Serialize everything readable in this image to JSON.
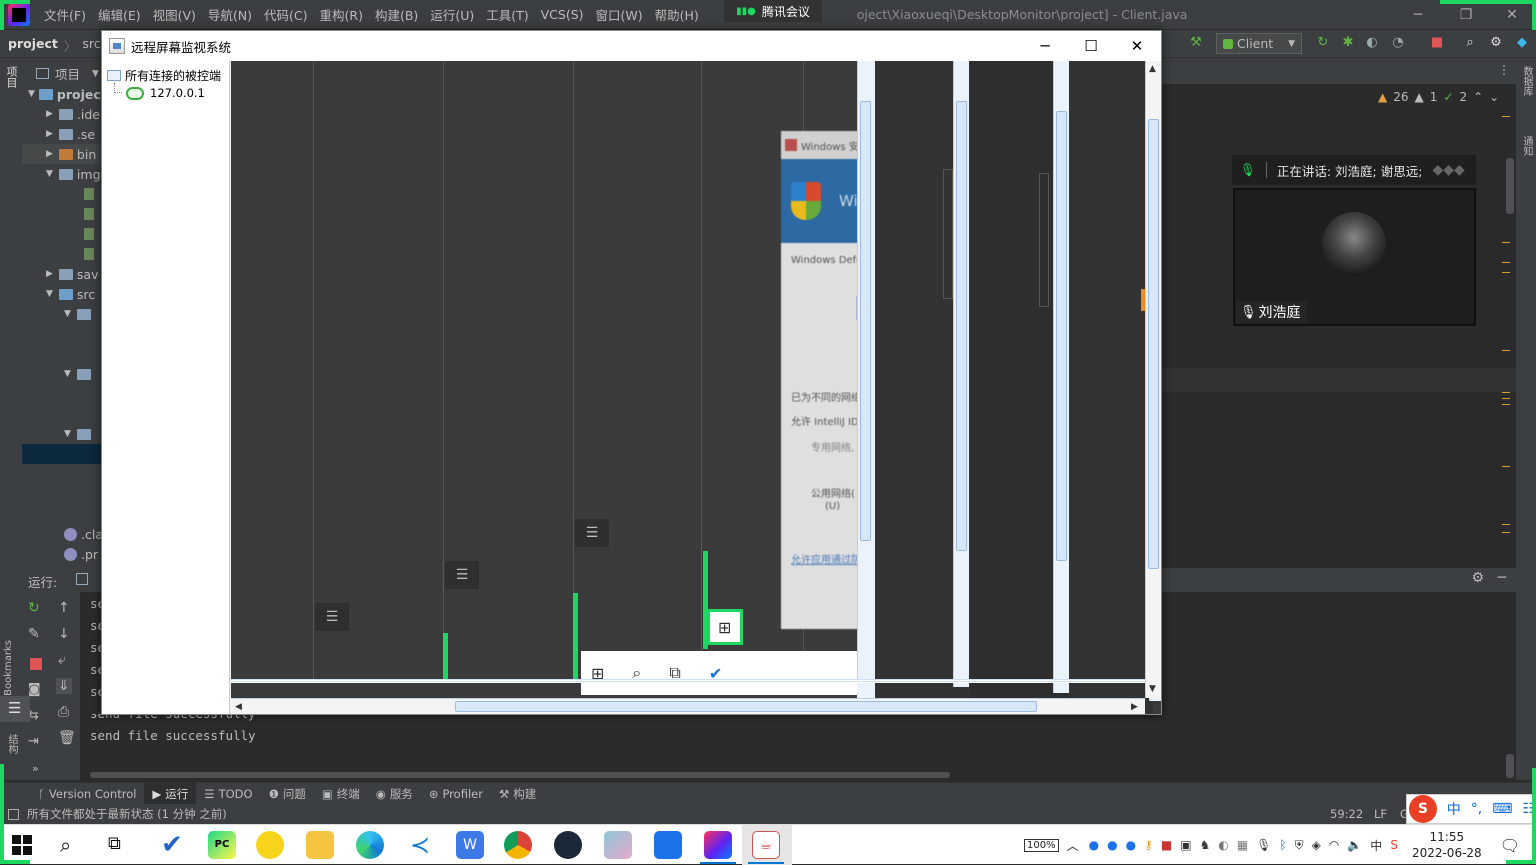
{
  "ide": {
    "menu": [
      "文件(F)",
      "编辑(E)",
      "视图(V)",
      "导航(N)",
      "代码(C)",
      "重构(R)",
      "构建(B)",
      "运行(U)",
      "工具(T)",
      "VCS(S)",
      "窗口(W)",
      "帮助(H)"
    ],
    "title_left": "proj",
    "title_right": "oject\\Xiaoxueqi\\DesktopMonitor\\project] - Client.java",
    "breadcrumb": [
      "project",
      "src"
    ],
    "run_config": "Client",
    "inspections": {
      "warnings": "26",
      "weak": "1",
      "typos": "2"
    },
    "project_label": "项目",
    "tree": [
      ".ide",
      ".se",
      "bin",
      "img",
      "sav",
      "src",
      ".cla",
      ".pr"
    ],
    "tree_root": "projec",
    "run_label": "运行:",
    "console": [
      "se",
      "se",
      "se",
      "se",
      "se",
      "send file successfully",
      "send file successfully"
    ],
    "bookmarks": "Bookmarks",
    "structure": "结构",
    "right_strip": [
      "数据库",
      "通知"
    ],
    "bottom_tabs": [
      "Version Control",
      "运行",
      "TODO",
      "问题",
      "终端",
      "服务",
      "Profiler",
      "构建"
    ],
    "status_text": "所有文件都处于最新状态 (1 分钟 之前)",
    "position": "59:22",
    "line_sep": "LF",
    "encoding": "G"
  },
  "meeting": {
    "badge": "腾讯会议",
    "speaking": "正在讲话: 刘浩庭; 谢思远;",
    "speaker": "刘浩庭"
  },
  "monitor": {
    "title": "远程屏幕监视系统",
    "tree_root": "所有连接的被控端",
    "client_ip": "127.0.0.1",
    "captured": {
      "sec_title": "Windows 安全",
      "sec_head": "Wind",
      "sec_defender": "Windows Defend",
      "sec_line1": "已为不同的网络类",
      "sec_line2": "允许 IntelliJ IDEA",
      "sec_opt1": "专用网络,",
      "sec_opt2": "公用网络(",
      "sec_opt3": "(U)",
      "sec_link": "允许应用通过防火"
    }
  },
  "taskbar": {
    "battery": "100%",
    "ime": "中",
    "time": "11:55",
    "date": "2022-06-28"
  }
}
